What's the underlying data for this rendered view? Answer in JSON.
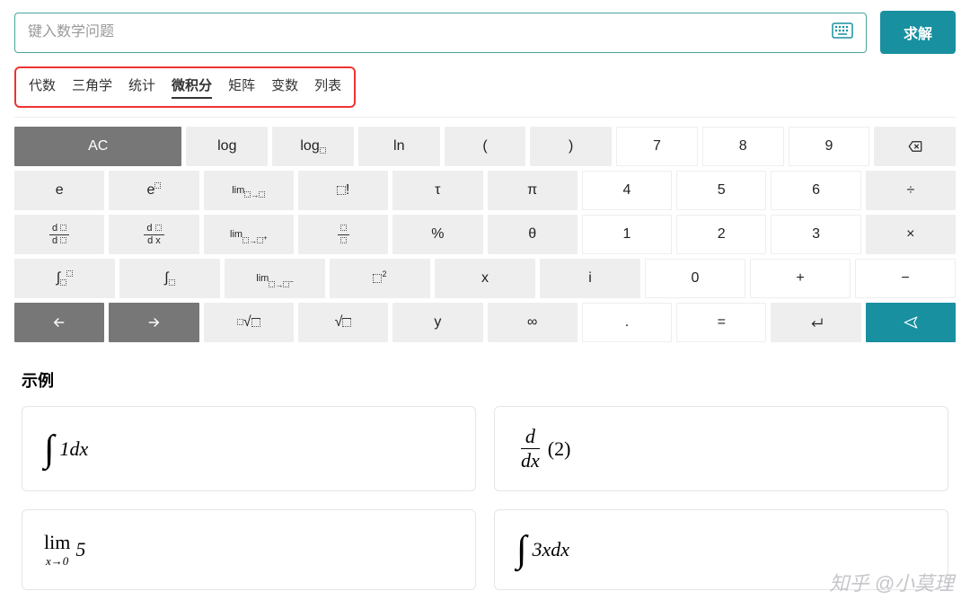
{
  "search": {
    "placeholder": "键入数学问题"
  },
  "solve_label": "求解",
  "tabs": [
    {
      "label": "代数",
      "active": false
    },
    {
      "label": "三角学",
      "active": false
    },
    {
      "label": "统计",
      "active": false
    },
    {
      "label": "微积分",
      "active": true
    },
    {
      "label": "矩阵",
      "active": false
    },
    {
      "label": "变数",
      "active": false
    },
    {
      "label": "列表",
      "active": false
    }
  ],
  "keypad": {
    "rows": [
      [
        {
          "kind": "dark",
          "name": "ac",
          "html": "AC",
          "span": 2
        },
        {
          "kind": "light",
          "name": "log",
          "html": "log"
        },
        {
          "kind": "light",
          "name": "log-base",
          "html": "log<span class='sub'><span class='box'></span></span>"
        },
        {
          "kind": "light",
          "name": "ln",
          "html": "ln"
        },
        {
          "kind": "light",
          "name": "lparen",
          "html": "("
        },
        {
          "kind": "light",
          "name": "rparen",
          "html": ")"
        },
        {
          "kind": "white",
          "name": "digit-7",
          "html": "7"
        },
        {
          "kind": "white",
          "name": "digit-8",
          "html": "8"
        },
        {
          "kind": "white",
          "name": "digit-9",
          "html": "9"
        },
        {
          "kind": "light",
          "name": "backspace",
          "svg": "backspace"
        }
      ],
      [
        {
          "kind": "light",
          "name": "e",
          "html": "e"
        },
        {
          "kind": "light",
          "name": "e-power",
          "html": "e<span class='sup'><span class='box'></span></span>"
        },
        {
          "kind": "light",
          "name": "limit",
          "html": "<span style='font-size:11px'>lim</span><br><span class='sub'><span class='box'></span>→<span class='box'></span></span>"
        },
        {
          "kind": "light",
          "name": "factorial",
          "html": "<span class='boxlg'></span>!"
        },
        {
          "kind": "light",
          "name": "tau",
          "html": "τ"
        },
        {
          "kind": "light",
          "name": "pi",
          "html": "π"
        },
        {
          "kind": "white",
          "name": "digit-4",
          "html": "4"
        },
        {
          "kind": "white",
          "name": "digit-5",
          "html": "5"
        },
        {
          "kind": "white",
          "name": "digit-6",
          "html": "6"
        },
        {
          "kind": "light",
          "name": "divide",
          "html": "÷"
        }
      ],
      [
        {
          "kind": "light",
          "name": "d-dbox",
          "html": "<span class='frac'><span class='num'>d <span class='box'></span></span><span class='den'>d <span class='box'></span></span></span>"
        },
        {
          "kind": "light",
          "name": "d-dx",
          "html": "<span class='frac'><span class='num'>d <span class='box'></span></span><span class='den'>d x</span></span>"
        },
        {
          "kind": "light",
          "name": "limit-right",
          "html": "<span style='font-size:11px'>lim</span><br><span class='sub'><span class='box'></span>→<span class='box'></span><sup>+</sup></span>"
        },
        {
          "kind": "light",
          "name": "fraction",
          "html": "<span class='frac'><span class='num'><span class='box'></span></span><span class='den'><span class='box'></span></span></span>"
        },
        {
          "kind": "light",
          "name": "percent",
          "html": "%"
        },
        {
          "kind": "light",
          "name": "theta",
          "html": "θ"
        },
        {
          "kind": "white",
          "name": "digit-1",
          "html": "1"
        },
        {
          "kind": "white",
          "name": "digit-2",
          "html": "2"
        },
        {
          "kind": "white",
          "name": "digit-3",
          "html": "3"
        },
        {
          "kind": "light",
          "name": "multiply",
          "html": "×"
        }
      ],
      [
        {
          "kind": "light",
          "name": "definite-integral",
          "html": "∫<span class='sub'><span class='box'></span></span><span class='sup'><span class='box'></span></span>"
        },
        {
          "kind": "light",
          "name": "indef-integral",
          "html": "∫<span class='sub'><span class='box'></span></span>"
        },
        {
          "kind": "light",
          "name": "limit-left",
          "html": "<span style='font-size:11px'>lim</span><br><span class='sub'><span class='box'></span>→<span class='box'></span><sup>−</sup></span>"
        },
        {
          "kind": "light",
          "name": "square",
          "html": "<span class='boxlg'></span><span class='sup'>2</span>"
        },
        {
          "kind": "light",
          "name": "var-x",
          "html": "x"
        },
        {
          "kind": "light",
          "name": "var-i",
          "html": "i"
        },
        {
          "kind": "white",
          "name": "digit-0",
          "html": "0"
        },
        {
          "kind": "white",
          "name": "plus",
          "html": "+"
        },
        {
          "kind": "white",
          "name": "minus",
          "html": "−"
        }
      ],
      [
        {
          "kind": "dark",
          "name": "arrow-left",
          "svg": "arrow-left"
        },
        {
          "kind": "dark",
          "name": "arrow-right",
          "svg": "arrow-right"
        },
        {
          "kind": "light",
          "name": "nth-root",
          "html": "<sup style='font-size:9px'><span class='box'></span></sup>√<span class='boxlg' style='border-top:1px solid #333;border-style:solid dotted dotted dotted'></span>"
        },
        {
          "kind": "light",
          "name": "sqrt",
          "html": "√<span class='boxlg' style='border-top:1px solid #333;border-style:solid dotted dotted dotted'></span>"
        },
        {
          "kind": "light",
          "name": "var-y",
          "html": "y"
        },
        {
          "kind": "light",
          "name": "infinity",
          "html": "∞"
        },
        {
          "kind": "white",
          "name": "dot",
          "html": "."
        },
        {
          "kind": "white",
          "name": "equals",
          "html": "="
        },
        {
          "kind": "light",
          "name": "enter",
          "svg": "enter"
        },
        {
          "kind": "teal",
          "name": "submit",
          "svg": "send"
        }
      ]
    ]
  },
  "examples": {
    "title": "示例",
    "items": [
      {
        "id": "int-1dx",
        "display": "∫ 1dx"
      },
      {
        "id": "ddx-2",
        "display": "d/dx (2)"
      },
      {
        "id": "lim-5",
        "display": "lim x→0 5"
      },
      {
        "id": "int-3xdx",
        "display": "∫ 3x dx"
      }
    ]
  },
  "watermark": "知乎 @小莫理"
}
